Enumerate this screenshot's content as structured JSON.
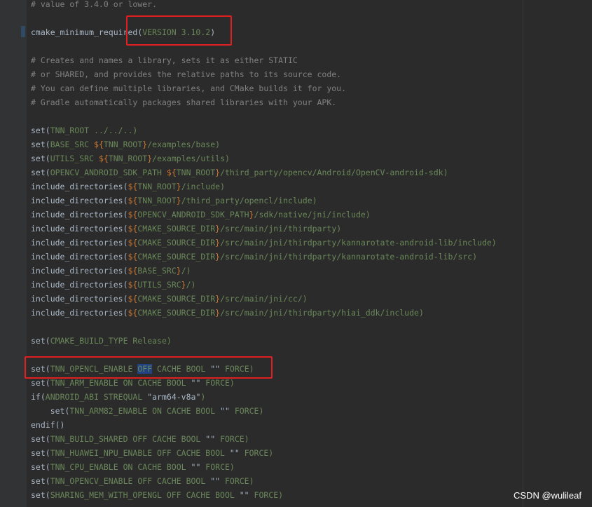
{
  "editor": {
    "lines": [
      {
        "tokens": [
          {
            "t": "c",
            "v": "# value of 3.4.0 or lower."
          }
        ]
      },
      {
        "tokens": []
      },
      {
        "tokens": [
          {
            "t": "k",
            "v": "cmake_minimum_required"
          },
          {
            "t": "p",
            "v": "("
          },
          {
            "t": "a",
            "v": "VERSION 3.10.2"
          },
          {
            "t": "p",
            "v": ")"
          }
        ]
      },
      {
        "tokens": []
      },
      {
        "tokens": [
          {
            "t": "c",
            "v": "# Creates and names a library, sets it as either STATIC"
          }
        ]
      },
      {
        "tokens": [
          {
            "t": "c",
            "v": "# or SHARED, and provides the relative paths to its source code."
          }
        ]
      },
      {
        "tokens": [
          {
            "t": "c",
            "v": "# You can define multiple libraries, and CMake builds it for you."
          }
        ]
      },
      {
        "tokens": [
          {
            "t": "c",
            "v": "# Gradle automatically packages shared libraries with your APK."
          }
        ]
      },
      {
        "tokens": []
      },
      {
        "tokens": [
          {
            "t": "k",
            "v": "set"
          },
          {
            "t": "p",
            "v": "("
          },
          {
            "t": "a",
            "v": "TNN_ROOT ../../..)"
          }
        ]
      },
      {
        "tokens": [
          {
            "t": "k",
            "v": "set"
          },
          {
            "t": "p",
            "v": "("
          },
          {
            "t": "a",
            "v": "BASE_SRC "
          },
          {
            "t": "v",
            "v": "${"
          },
          {
            "t": "a",
            "v": "TNN_ROOT"
          },
          {
            "t": "v",
            "v": "}"
          },
          {
            "t": "a",
            "v": "/examples/base)"
          }
        ]
      },
      {
        "tokens": [
          {
            "t": "k",
            "v": "set"
          },
          {
            "t": "p",
            "v": "("
          },
          {
            "t": "a",
            "v": "UTILS_SRC "
          },
          {
            "t": "v",
            "v": "${"
          },
          {
            "t": "a",
            "v": "TNN_ROOT"
          },
          {
            "t": "v",
            "v": "}"
          },
          {
            "t": "a",
            "v": "/examples/utils)"
          }
        ]
      },
      {
        "tokens": [
          {
            "t": "k",
            "v": "set"
          },
          {
            "t": "p",
            "v": "("
          },
          {
            "t": "a",
            "v": "OPENCV_ANDROID_SDK_PATH "
          },
          {
            "t": "v",
            "v": "${"
          },
          {
            "t": "a",
            "v": "TNN_ROOT"
          },
          {
            "t": "v",
            "v": "}"
          },
          {
            "t": "a",
            "v": "/third_party/opencv/Android/OpenCV-android-sdk)"
          }
        ]
      },
      {
        "tokens": [
          {
            "t": "k",
            "v": "include_directories"
          },
          {
            "t": "p",
            "v": "("
          },
          {
            "t": "v",
            "v": "${"
          },
          {
            "t": "a",
            "v": "TNN_ROOT"
          },
          {
            "t": "v",
            "v": "}"
          },
          {
            "t": "a",
            "v": "/include)"
          }
        ]
      },
      {
        "tokens": [
          {
            "t": "k",
            "v": "include_directories"
          },
          {
            "t": "p",
            "v": "("
          },
          {
            "t": "v",
            "v": "${"
          },
          {
            "t": "a",
            "v": "TNN_ROOT"
          },
          {
            "t": "v",
            "v": "}"
          },
          {
            "t": "a",
            "v": "/third_party/opencl/include)"
          }
        ]
      },
      {
        "tokens": [
          {
            "t": "k",
            "v": "include_directories"
          },
          {
            "t": "p",
            "v": "("
          },
          {
            "t": "v",
            "v": "${"
          },
          {
            "t": "a",
            "v": "OPENCV_ANDROID_SDK_PATH"
          },
          {
            "t": "v",
            "v": "}"
          },
          {
            "t": "a",
            "v": "/sdk/native/jni/include)"
          }
        ]
      },
      {
        "tokens": [
          {
            "t": "k",
            "v": "include_directories"
          },
          {
            "t": "p",
            "v": "("
          },
          {
            "t": "v",
            "v": "${"
          },
          {
            "t": "a",
            "v": "CMAKE_SOURCE_DIR"
          },
          {
            "t": "v",
            "v": "}"
          },
          {
            "t": "a",
            "v": "/src/main/jni/thirdparty)"
          }
        ]
      },
      {
        "tokens": [
          {
            "t": "k",
            "v": "include_directories"
          },
          {
            "t": "p",
            "v": "("
          },
          {
            "t": "v",
            "v": "${"
          },
          {
            "t": "a",
            "v": "CMAKE_SOURCE_DIR"
          },
          {
            "t": "v",
            "v": "}"
          },
          {
            "t": "a",
            "v": "/src/main/jni/thirdparty/kannarotate-android-lib/include)"
          }
        ]
      },
      {
        "tokens": [
          {
            "t": "k",
            "v": "include_directories"
          },
          {
            "t": "p",
            "v": "("
          },
          {
            "t": "v",
            "v": "${"
          },
          {
            "t": "a",
            "v": "CMAKE_SOURCE_DIR"
          },
          {
            "t": "v",
            "v": "}"
          },
          {
            "t": "a",
            "v": "/src/main/jni/thirdparty/kannarotate-android-lib/src)"
          }
        ]
      },
      {
        "tokens": [
          {
            "t": "k",
            "v": "include_directories"
          },
          {
            "t": "p",
            "v": "("
          },
          {
            "t": "v",
            "v": "${"
          },
          {
            "t": "a",
            "v": "BASE_SRC"
          },
          {
            "t": "v",
            "v": "}"
          },
          {
            "t": "a",
            "v": "/)"
          }
        ]
      },
      {
        "tokens": [
          {
            "t": "k",
            "v": "include_directories"
          },
          {
            "t": "p",
            "v": "("
          },
          {
            "t": "v",
            "v": "${"
          },
          {
            "t": "a",
            "v": "UTILS_SRC"
          },
          {
            "t": "v",
            "v": "}"
          },
          {
            "t": "a",
            "v": "/)"
          }
        ]
      },
      {
        "tokens": [
          {
            "t": "k",
            "v": "include_directories"
          },
          {
            "t": "p",
            "v": "("
          },
          {
            "t": "v",
            "v": "${"
          },
          {
            "t": "a",
            "v": "CMAKE_SOURCE_DIR"
          },
          {
            "t": "v",
            "v": "}"
          },
          {
            "t": "a",
            "v": "/src/main/jni/cc/)"
          }
        ]
      },
      {
        "tokens": [
          {
            "t": "k",
            "v": "include_directories"
          },
          {
            "t": "p",
            "v": "("
          },
          {
            "t": "v",
            "v": "${"
          },
          {
            "t": "a",
            "v": "CMAKE_SOURCE_DIR"
          },
          {
            "t": "v",
            "v": "}"
          },
          {
            "t": "a",
            "v": "/src/main/jni/thirdparty/hiai_ddk/include)"
          }
        ]
      },
      {
        "tokens": []
      },
      {
        "tokens": [
          {
            "t": "k",
            "v": "set"
          },
          {
            "t": "p",
            "v": "("
          },
          {
            "t": "a",
            "v": "CMAKE_BUILD_TYPE Release)"
          }
        ]
      },
      {
        "tokens": []
      },
      {
        "tokens": [
          {
            "t": "k",
            "v": "set"
          },
          {
            "t": "p",
            "v": "("
          },
          {
            "t": "a",
            "v": "TNN_OPENCL_ENABLE "
          },
          {
            "t": "h",
            "v": "OFF"
          },
          {
            "t": "a",
            "v": " CACHE BOOL "
          },
          {
            "t": "p",
            "v": "\"\""
          },
          {
            "t": "a",
            "v": " FORCE)"
          }
        ]
      },
      {
        "tokens": [
          {
            "t": "k",
            "v": "set"
          },
          {
            "t": "p",
            "v": "("
          },
          {
            "t": "a",
            "v": "TNN_ARM_ENABLE ON CACHE BOOL "
          },
          {
            "t": "p",
            "v": "\"\""
          },
          {
            "t": "a",
            "v": " FORCE)"
          }
        ]
      },
      {
        "tokens": [
          {
            "t": "k",
            "v": "if"
          },
          {
            "t": "p",
            "v": "("
          },
          {
            "t": "a",
            "v": "ANDROID_ABI STREQUAL "
          },
          {
            "t": "p",
            "v": "\"arm64-v8a\""
          },
          {
            "t": "a",
            "v": ")"
          }
        ]
      },
      {
        "tokens": [
          {
            "t": "p",
            "v": "    "
          },
          {
            "t": "k",
            "v": "set"
          },
          {
            "t": "p",
            "v": "("
          },
          {
            "t": "a",
            "v": "TNN_ARM82_ENABLE ON CACHE BOOL "
          },
          {
            "t": "p",
            "v": "\"\""
          },
          {
            "t": "a",
            "v": " FORCE)"
          }
        ]
      },
      {
        "tokens": [
          {
            "t": "k",
            "v": "endif"
          },
          {
            "t": "p",
            "v": "()"
          }
        ]
      },
      {
        "tokens": [
          {
            "t": "k",
            "v": "set"
          },
          {
            "t": "p",
            "v": "("
          },
          {
            "t": "a",
            "v": "TNN_BUILD_SHARED OFF CACHE BOOL "
          },
          {
            "t": "p",
            "v": "\"\""
          },
          {
            "t": "a",
            "v": " FORCE)"
          }
        ]
      },
      {
        "tokens": [
          {
            "t": "k",
            "v": "set"
          },
          {
            "t": "p",
            "v": "("
          },
          {
            "t": "a",
            "v": "TNN_HUAWEI_NPU_ENABLE OFF CACHE BOOL "
          },
          {
            "t": "p",
            "v": "\"\""
          },
          {
            "t": "a",
            "v": " FORCE)"
          }
        ]
      },
      {
        "tokens": [
          {
            "t": "k",
            "v": "set"
          },
          {
            "t": "p",
            "v": "("
          },
          {
            "t": "a",
            "v": "TNN_CPU_ENABLE ON CACHE BOOL "
          },
          {
            "t": "p",
            "v": "\"\""
          },
          {
            "t": "a",
            "v": " FORCE)"
          }
        ]
      },
      {
        "tokens": [
          {
            "t": "k",
            "v": "set"
          },
          {
            "t": "p",
            "v": "("
          },
          {
            "t": "a",
            "v": "TNN_OPENCV_ENABLE OFF CACHE BOOL "
          },
          {
            "t": "p",
            "v": "\"\""
          },
          {
            "t": "a",
            "v": " FORCE)"
          }
        ]
      },
      {
        "tokens": [
          {
            "t": "k",
            "v": "set"
          },
          {
            "t": "p",
            "v": "("
          },
          {
            "t": "a",
            "v": "SHARING_MEM_WITH_OPENGL OFF CACHE BOOL "
          },
          {
            "t": "p",
            "v": "\"\""
          },
          {
            "t": "a",
            "v": " FORCE)"
          }
        ]
      }
    ]
  },
  "watermark": "CSDN @wulileaf",
  "colors": {
    "background": "#2b2b2b",
    "comment": "#808080",
    "command": "#a9b7c6",
    "argument": "#6a8759",
    "variable": "#cc7832",
    "highlight": "#214283",
    "annotation_box": "#e02020"
  }
}
